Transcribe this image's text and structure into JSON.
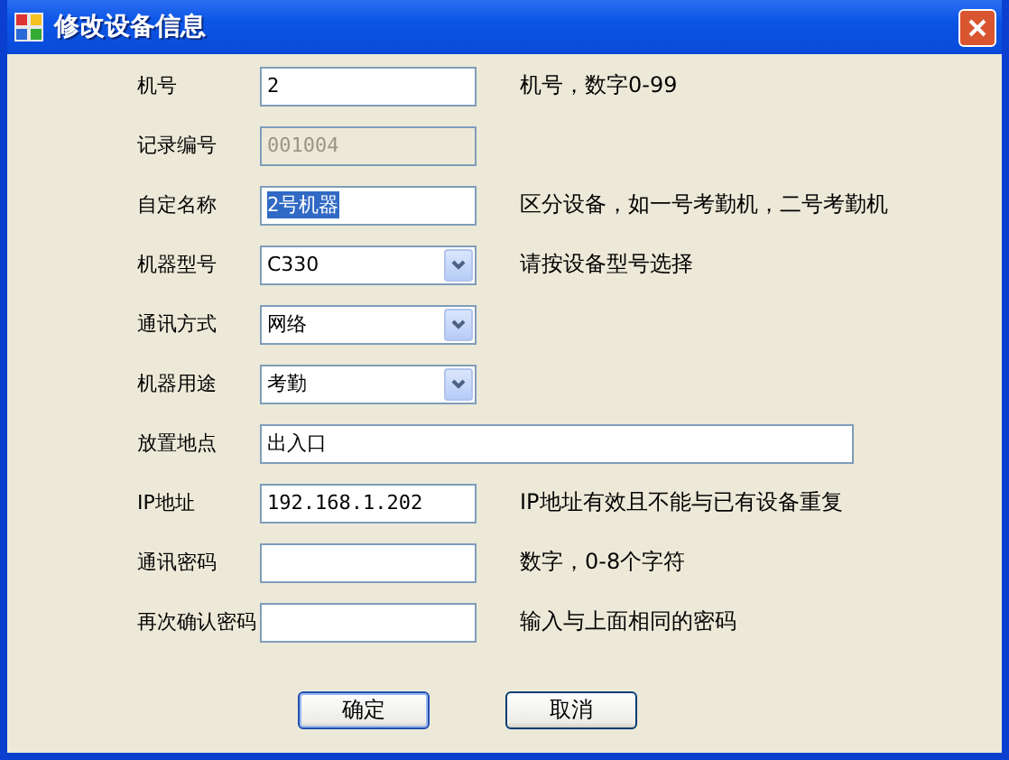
{
  "window": {
    "title": "修改设备信息"
  },
  "rows": [
    {
      "label": "机号",
      "field": {
        "kind": "text",
        "value": "2"
      },
      "hint": "机号，数字0-99"
    },
    {
      "label": "记录编号",
      "field": {
        "kind": "text",
        "value": "001004",
        "disabled": true
      }
    },
    {
      "label": "自定名称",
      "field": {
        "kind": "text",
        "value": "2号机器",
        "highlighted": true
      },
      "hint": "区分设备，如一号考勤机，二号考勤机"
    },
    {
      "label": "机器型号",
      "field": {
        "kind": "combo",
        "value": "C330"
      },
      "hint": "请按设备型号选择"
    },
    {
      "label": "通讯方式",
      "field": {
        "kind": "combo",
        "value": "网络"
      }
    },
    {
      "label": "机器用途",
      "field": {
        "kind": "combo",
        "value": "考勤"
      }
    },
    {
      "label": "放置地点",
      "field": {
        "kind": "wide",
        "value": "出入口"
      }
    },
    {
      "label": "IP地址",
      "field": {
        "kind": "text",
        "value": "192.168.1.202"
      },
      "hint": "IP地址有效且不能与已有设备重复"
    },
    {
      "label": "通讯密码",
      "field": {
        "kind": "text"
      },
      "hint": "数字，0-8个字符"
    },
    {
      "label": "再次确认密码",
      "field": {
        "kind": "text"
      },
      "hint": "输入与上面相同的密码"
    }
  ],
  "buttons": [
    {
      "label": "确定",
      "default": true
    },
    {
      "label": "取消",
      "default": false
    }
  ]
}
